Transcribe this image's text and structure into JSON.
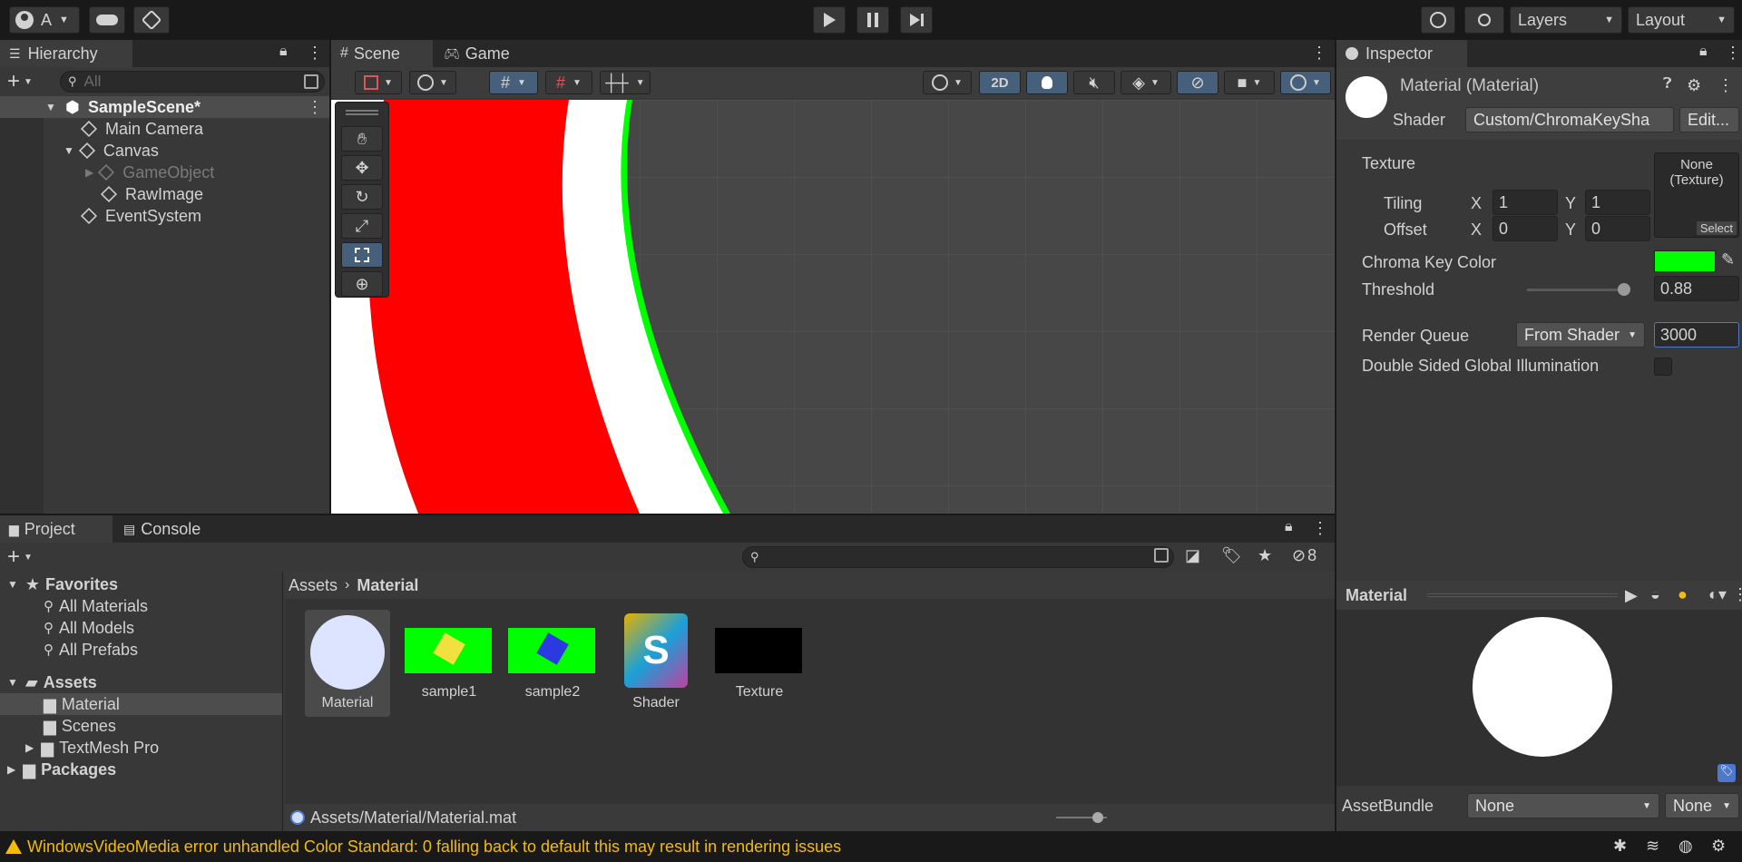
{
  "toolbar": {
    "account_label": "A",
    "layers_label": "Layers",
    "layout_label": "Layout"
  },
  "hierarchy": {
    "tab_label": "Hierarchy",
    "search_placeholder": "All",
    "items": [
      {
        "label": "SampleScene*"
      },
      {
        "label": "Main Camera"
      },
      {
        "label": "Canvas"
      },
      {
        "label": "GameObject"
      },
      {
        "label": "RawImage"
      },
      {
        "label": "EventSystem"
      }
    ]
  },
  "scene": {
    "tabs": [
      {
        "label": "Scene"
      },
      {
        "label": "Game"
      }
    ],
    "mode_2d": "2D"
  },
  "inspector": {
    "tab_label": "Inspector",
    "title": "Material (Material)",
    "shader_label": "Shader",
    "shader_value": "Custom/ChromaKeySha",
    "edit_label": "Edit...",
    "texture_label": "Texture",
    "texture_none": "None",
    "texture_type": "(Texture)",
    "texture_select": "Select",
    "tiling_label": "Tiling",
    "offset_label": "Offset",
    "x_label": "X",
    "y_label": "Y",
    "tiling_x": "1",
    "tiling_y": "1",
    "offset_x": "0",
    "offset_y": "0",
    "chroma_label": "Chroma Key Color",
    "chroma_color": "#00ff00",
    "threshold_label": "Threshold",
    "threshold_value": "0.88",
    "threshold_fraction": 0.88,
    "render_queue_label": "Render Queue",
    "render_queue_mode": "From Shader",
    "render_queue_value": "3000",
    "dsgi_label": "Double Sided Global Illumination"
  },
  "preview": {
    "title": "Material",
    "assetbundle_label": "AssetBundle",
    "assetbundle_value": "None",
    "assetbundle_variant": "None"
  },
  "project": {
    "tabs": [
      {
        "label": "Project"
      },
      {
        "label": "Console"
      }
    ],
    "hidden_count": "8",
    "tree": [
      {
        "label": "Favorites"
      },
      {
        "label": "All Materials"
      },
      {
        "label": "All Models"
      },
      {
        "label": "All Prefabs"
      },
      {
        "label": "Assets"
      },
      {
        "label": "Material"
      },
      {
        "label": "Scenes"
      },
      {
        "label": "TextMesh Pro"
      },
      {
        "label": "Packages"
      }
    ],
    "breadcrumb_root": "Assets",
    "breadcrumb_current": "Material",
    "assets": [
      {
        "label": "Material"
      },
      {
        "label": "sample1"
      },
      {
        "label": "sample2"
      },
      {
        "label": "Shader"
      },
      {
        "label": "Texture"
      }
    ],
    "shader_letter": "S",
    "footer_path": "Assets/Material/Material.mat"
  },
  "status": {
    "message": "WindowsVideoMedia error unhandled Color Standard: 0  falling back to default this may result in rendering issues"
  },
  "colors": {
    "accent": "#4d78cc",
    "warning": "#f4bc02",
    "chroma": "#00ff00",
    "sample_red": "#ff0000"
  }
}
